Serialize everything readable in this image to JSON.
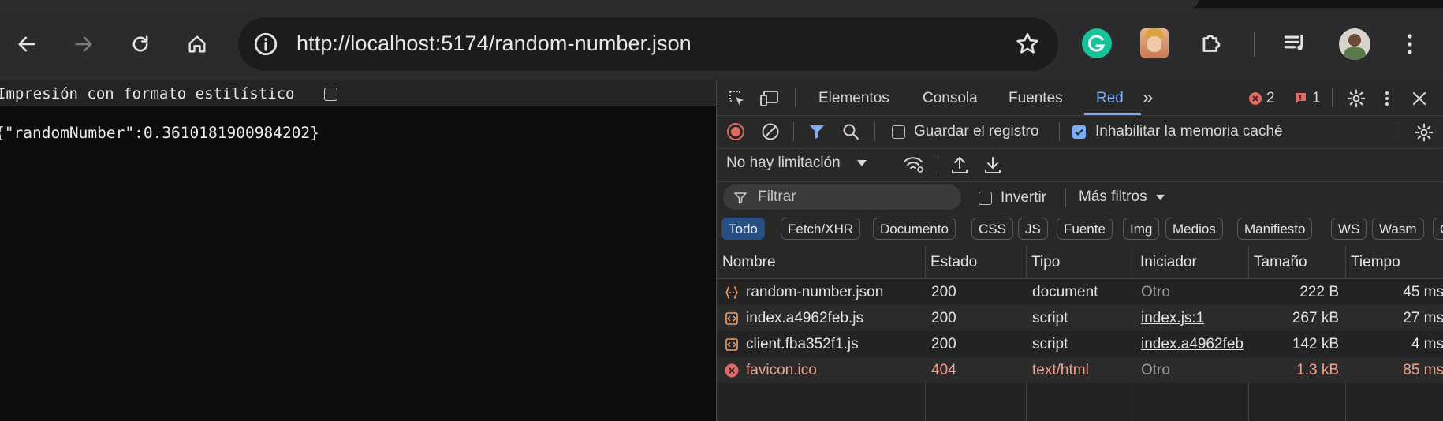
{
  "browser": {
    "url": "http://localhost:5174/random-number.json",
    "back_icon": "arrow-left-icon",
    "forward_icon": "arrow-right-icon",
    "reload_icon": "reload-icon",
    "home_icon": "home-icon"
  },
  "page": {
    "pretty_print_label": "Impresión con formato estilístico",
    "pretty_print_checked": false,
    "json_text": "{\"randomNumber\":0.3610181900984202}"
  },
  "devtools": {
    "tabs": [
      "Elementos",
      "Consola",
      "Fuentes",
      "Red"
    ],
    "active_tab": "Red",
    "more_tabs": "»",
    "error_count": "2",
    "issue_count": "1",
    "toolbar": {
      "preserve_log_label": "Guardar el registro",
      "preserve_log_checked": false,
      "disable_cache_label": "Inhabilitar la memoria caché",
      "disable_cache_checked": true,
      "throttling": "No hay limitación"
    },
    "filter": {
      "placeholder": "Filtrar",
      "invert_label": "Invertir",
      "more_filters_label": "Más filtros"
    },
    "type_chips": [
      "Todo",
      "Fetch/XHR",
      "Documento",
      "CSS",
      "JS",
      "Fuente",
      "Img",
      "Medios",
      "Manifiesto",
      "WS",
      "Wasm",
      "O"
    ],
    "active_chip": "Todo",
    "columns": [
      "Nombre",
      "Estado",
      "Tipo",
      "Iniciador",
      "Tamaño",
      "Tiempo"
    ],
    "rows": [
      {
        "name": "random-number.json",
        "status": "200",
        "type": "document",
        "initiator": "Otro",
        "size": "222 B",
        "time": "45 ms",
        "icon": "json-file-icon",
        "error": false
      },
      {
        "name": "index.a4962feb.js",
        "status": "200",
        "type": "script",
        "initiator": "index.js:1",
        "size": "267 kB",
        "time": "27 ms",
        "icon": "script-file-icon",
        "error": false
      },
      {
        "name": "client.fba352f1.js",
        "status": "200",
        "type": "script",
        "initiator": "index.a4962feb",
        "size": "142 kB",
        "time": "4 ms",
        "icon": "script-file-icon",
        "error": false
      },
      {
        "name": "favicon.ico",
        "status": "404",
        "type": "text/html",
        "initiator": "Otro",
        "size": "1.3 kB",
        "time": "85 ms",
        "icon": "error-circle-icon",
        "error": true
      }
    ]
  },
  "colors": {
    "accent": "#7cacf8",
    "error": "#f2a18f",
    "record": "#e46962",
    "grammarly": "#15c39a"
  }
}
